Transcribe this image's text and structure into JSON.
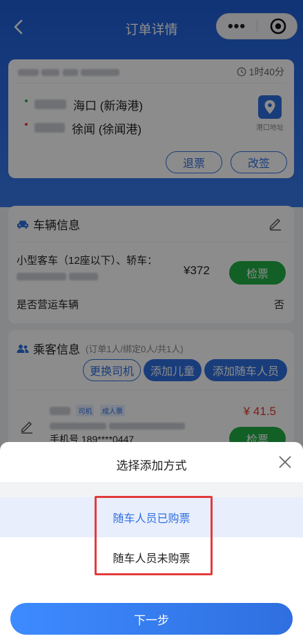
{
  "navbar": {
    "title": "订单详情",
    "more_glyph": "•••"
  },
  "trip": {
    "duration": "1时40分",
    "depart_port": "海口 (新海港)",
    "arrive_port": "徐闻 (徐闻港)",
    "map_label": "港口地址",
    "refund_label": "退票",
    "change_label": "改签"
  },
  "vehicle": {
    "section_title": "车辆信息",
    "type_text": "小型客车（12座以下）、轿车：",
    "price": "¥372",
    "check_label": "检票",
    "operating_label": "是否营运车辆",
    "operating_value": "否"
  },
  "passenger": {
    "section_title": "乘客信息",
    "sub_note": "(订单1人/绑定0人/共1人)",
    "change_driver": "更换司机",
    "add_child": "添加儿童",
    "add_companion": "添加随车人员",
    "tag_driver": "司机",
    "tag_adult": "成人票",
    "price": "¥ 41.5",
    "check_label": "检票",
    "phone": "手机号 189****0447"
  },
  "sheet": {
    "title": "选择添加方式",
    "option_purchased": "随车人员已购票",
    "option_not_purchased": "随车人员未购票",
    "next_label": "下一步"
  },
  "colors": {
    "brand_blue": "#2f6fe0",
    "check_green": "#22b046",
    "price_red": "#e8352e",
    "highlight_red": "#e23b3b"
  }
}
